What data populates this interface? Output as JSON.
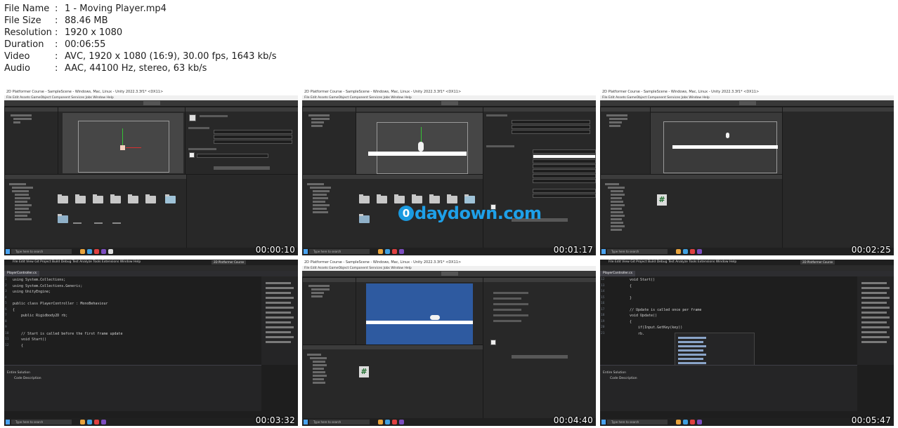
{
  "info": [
    {
      "key": "File Name",
      "value": "1 - Moving Player.mp4"
    },
    {
      "key": "File Size",
      "value": "88.46 MB"
    },
    {
      "key": "Resolution",
      "value": "1920 x 1080"
    },
    {
      "key": "Duration",
      "value": "00:06:55"
    },
    {
      "key": "Video",
      "value": "AVC, 1920 x 1080 (16:9), 30.00 fps, 1643 kb/s"
    },
    {
      "key": "Audio",
      "value": "AAC, 44100 Hz, stereo, 63 kb/s"
    }
  ],
  "thumbs": [
    {
      "timestamp": "00:00:10"
    },
    {
      "timestamp": "00:01:17"
    },
    {
      "timestamp": "00:02:25"
    },
    {
      "timestamp": "00:03:32"
    },
    {
      "timestamp": "00:04:40"
    },
    {
      "timestamp": "00:05:47"
    }
  ],
  "unity": {
    "title": "2D Platformer Course - SampleScene - Windows, Mac, Linux - Unity 2022.3.3f1* <DX11>",
    "menu": "File  Edit  Assets  GameObject  Component  Services  Jobs  Window  Help"
  },
  "vs": {
    "menu": "File   Edit   View   Git   Project   Build   Debug   Test   Analyze   Tools   Extensions   Window   Help",
    "badge": "2D Platformer Course",
    "tab": "PlayerController.cs",
    "code_a": "using System.Collections;\nusing System.Collections.Generic;\nusing UnityEngine;\n\npublic class PlayerController : MonoBehaviour\n{\n    public Rigidbody2D rb;\n\n\n    // Start is called before the first frame update\n    void Start()\n    {",
    "gutter_a": "1\n2\n3\n4\n5\n6\n7\n8\n9\n10\n11\n12",
    "code_b": "void Start()\n{\n\n}\n\n// Update is called once per frame\nvoid Update()\n{\n    if(Input.GetKey(key))\n    rb.",
    "gutter_b": "12\n13\n14\n15\n16\n17\n18\n19\n20\n21",
    "errors": "Entire Solution",
    "code_col": "Code   Description"
  },
  "taskbar": {
    "search": "Type here to search"
  },
  "watermark": {
    "glyph": "0",
    "text": "daydown.com"
  },
  "colors": {
    "unity_bg": "#282828",
    "scene_bg": "#464646",
    "game_bg": "#2e5aa0",
    "vs_bg": "#1e1e1e"
  }
}
